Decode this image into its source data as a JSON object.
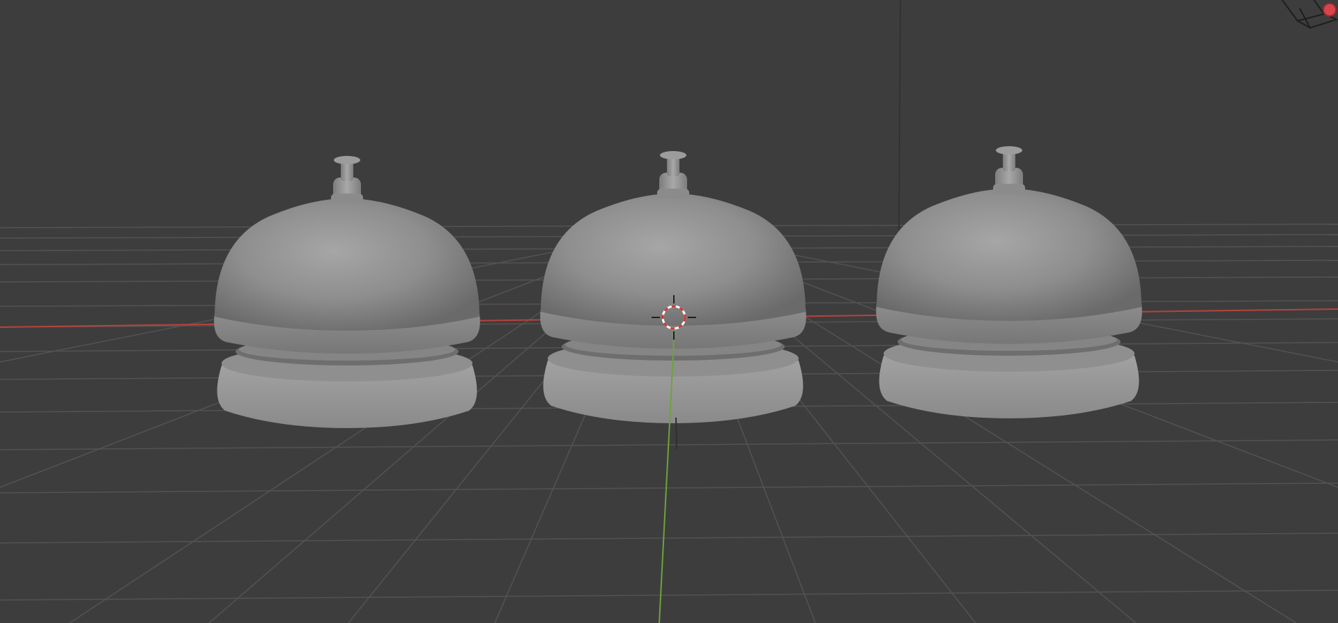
{
  "app": {
    "name": "3D Viewport",
    "shading_mode": "solid"
  },
  "scene": {
    "objects": [
      {
        "name": "bell",
        "type": "mesh",
        "color": "#8c8c8c"
      },
      {
        "name": "bell",
        "type": "mesh",
        "color": "#8c8c8c"
      },
      {
        "name": "bell",
        "type": "mesh",
        "color": "#8c8c8c"
      }
    ],
    "grid_visible": true,
    "axis_colors": {
      "x": "#b8423e",
      "y": "#6fa23a",
      "z": "#2f2f2f"
    },
    "background_color": "#3d3d3d",
    "grid_color": "#555555"
  },
  "icons": {
    "cursor": "3d-cursor-icon",
    "gizmo": "navigation-gizmo-icon"
  }
}
